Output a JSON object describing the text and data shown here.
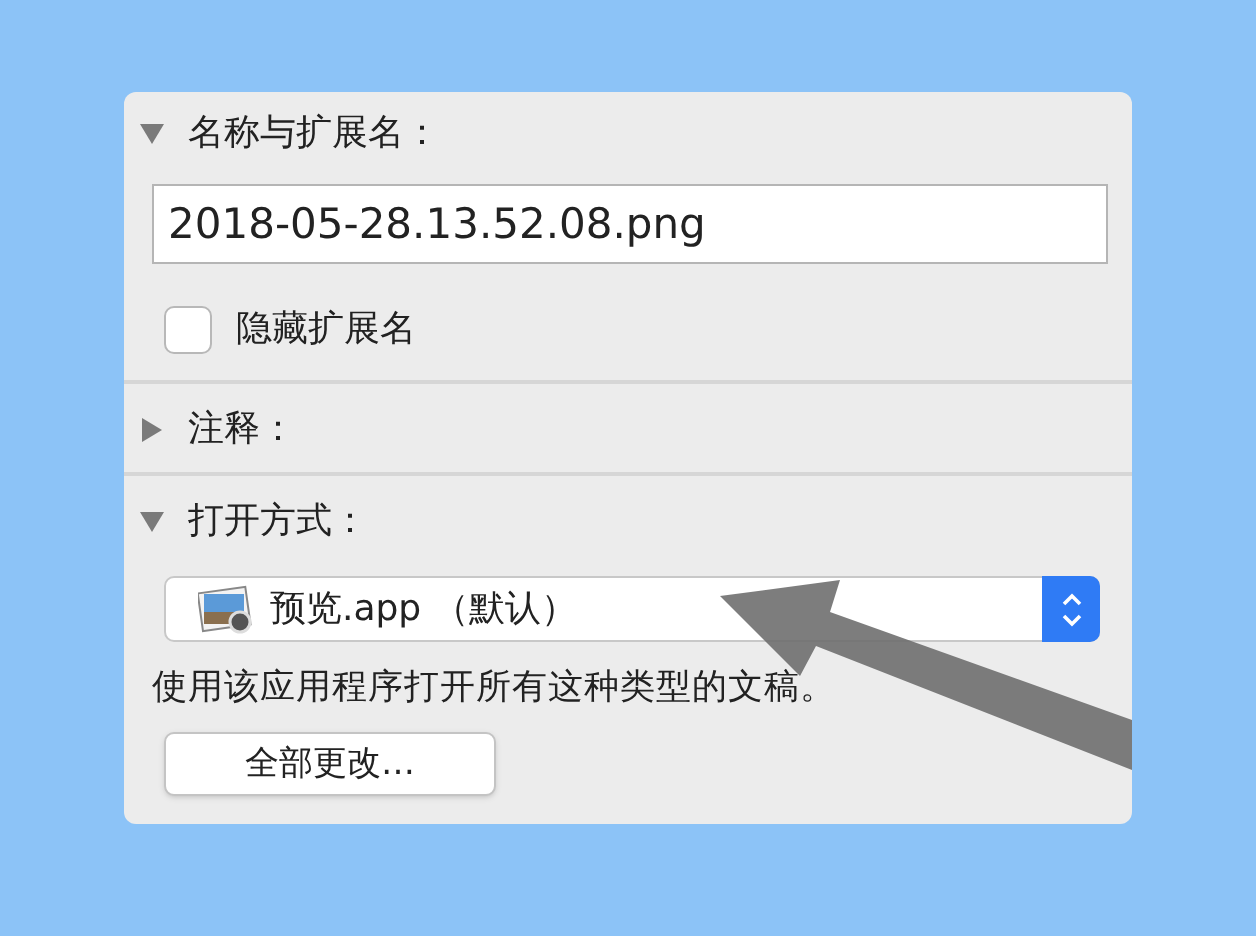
{
  "sections": [
    {
      "title": "名称与扩展名：",
      "expanded": true,
      "kind": "name",
      "field_value": "2018-05-28.13.52.08.png",
      "checkbox": {
        "label": "隐藏扩展名",
        "checked": false
      }
    },
    {
      "title": "注释：",
      "expanded": false
    },
    {
      "title": "打开方式：",
      "expanded": true,
      "kind": "open_with",
      "app": "预览.app （默认）",
      "description": "使用该应用程序打开所有这种类型的文稿。",
      "button": "全部更改…"
    }
  ],
  "annotation": {
    "kind": "arrow"
  }
}
